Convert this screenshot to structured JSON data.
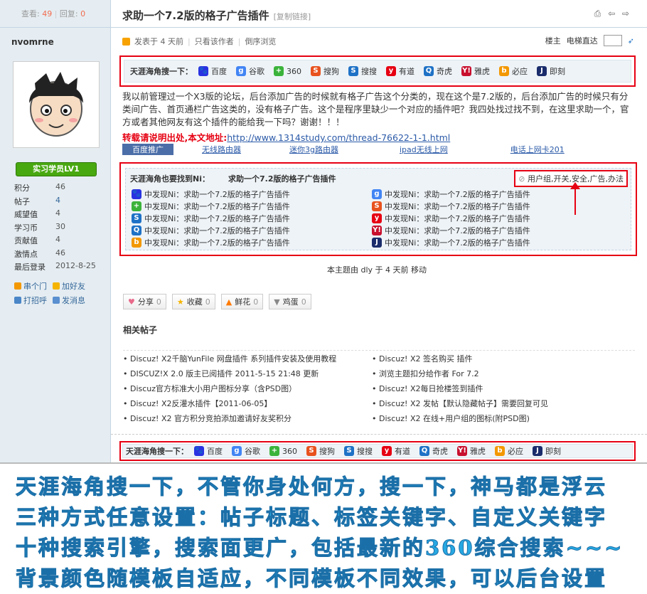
{
  "thread": {
    "views_label": "查看:",
    "views": "49",
    "replies_label": "回复:",
    "replies": "0",
    "title": "求助一个7.2版的格子广告插件",
    "copy_link": "[复制链接]",
    "header_icons": "⎙ ⇦ ⇨"
  },
  "author": {
    "username": "nvomrne",
    "level": "实习学员LV1",
    "stats": [
      {
        "k": "积分",
        "v": "46"
      },
      {
        "k": "帖子",
        "v": "4"
      },
      {
        "k": "威望值",
        "v": "4"
      },
      {
        "k": "学习币",
        "v": "30"
      },
      {
        "k": "贡献值",
        "v": "4"
      },
      {
        "k": "激情点",
        "v": "46"
      },
      {
        "k": "最后登录",
        "v": "2012-8-25"
      }
    ],
    "links": {
      "visit": "串个门",
      "add_friend": "加好友",
      "greet": "打招呼",
      "message": "发消息"
    }
  },
  "meta": {
    "posted": "发表于 4 天前",
    "author_only": "只看该作者",
    "reverse": "倒序浏览",
    "floor": "楼主",
    "elevator": "电梯直达"
  },
  "search_bar": {
    "label": "天涯海角搜一下：",
    "engines": [
      {
        "name": "百度",
        "icon": "baidu-icon",
        "color": "#2932e1",
        "glyph": "🐾"
      },
      {
        "name": "谷歌",
        "icon": "google-icon",
        "color": "#4285f4",
        "glyph": "g"
      },
      {
        "name": "360",
        "icon": "360-icon",
        "color": "#3bb33b",
        "glyph": "+"
      },
      {
        "name": "搜狗",
        "icon": "sogou-icon",
        "color": "#e8521e",
        "glyph": "S"
      },
      {
        "name": "搜搜",
        "icon": "soso-icon",
        "color": "#1e72c6",
        "glyph": "S"
      },
      {
        "name": "有道",
        "icon": "youdao-icon",
        "color": "#e60012",
        "glyph": "y"
      },
      {
        "name": "奇虎",
        "icon": "qihoo-icon",
        "color": "#1e72c6",
        "glyph": "Q"
      },
      {
        "name": "雅虎",
        "icon": "yahoo-icon",
        "color": "#c8102e",
        "glyph": "Y!"
      },
      {
        "name": "必应",
        "icon": "bing-icon",
        "color": "#f39800",
        "glyph": "b"
      },
      {
        "name": "即刻",
        "icon": "jike-icon",
        "color": "#1a2c6b",
        "glyph": "J"
      }
    ]
  },
  "post": {
    "body": "我以前管理过一个X3版的论坛，后台添加广告的时候就有格子广告这个分类的，现在这个是7.2版的，后台添加广告的时候只有分类间广告、首页通栏广告这类的，没有格子广告。这个是程序里缺少一个对应的插件吧？我四处找过找不到，在这里求助一个，官方或者其他网友有这个插件的能给我一下吗？谢谢！！！",
    "repost_label": "转载请说明出处,本文地址:",
    "repost_url": "http://www.1314study.com/thread-76622-1-1.html",
    "ads": [
      "百度推广",
      "无线路由器",
      "迷你3g路由器",
      "ipad无线上网",
      "电话上网卡201"
    ]
  },
  "related_search": {
    "heading": "天涯海角也要找到Ni：",
    "query": "求助一个7.2版的格子广告插件",
    "tags": "用户组,开关,安全,广告,办法",
    "item_prefix": "中发现Ni：",
    "left": [
      {
        "icon": "baidu-icon",
        "color": "#2932e1",
        "glyph": "🐾",
        "text": "中发现Ni：求助一个7.2版的格子广告插件"
      },
      {
        "icon": "360-icon",
        "color": "#3bb33b",
        "glyph": "+",
        "text": "中发现Ni：求助一个7.2版的格子广告插件"
      },
      {
        "icon": "soso-icon",
        "color": "#1e72c6",
        "glyph": "S",
        "text": "中发现Ni：求助一个7.2版的格子广告插件"
      },
      {
        "icon": "qihoo-icon",
        "color": "#1e72c6",
        "glyph": "Q",
        "text": "中发现Ni：求助一个7.2版的格子广告插件"
      },
      {
        "icon": "bing-icon",
        "color": "#f39800",
        "glyph": "b",
        "text": "中发现Ni：求助一个7.2版的格子广告插件"
      }
    ],
    "right": [
      {
        "icon": "google-icon",
        "color": "#4285f4",
        "glyph": "g",
        "text": "中发现Ni：求助一个7.2版的格子广告插件"
      },
      {
        "icon": "sogou-icon",
        "color": "#e8521e",
        "glyph": "S",
        "text": "中发现Ni：求助一个7.2版的格子广告插件"
      },
      {
        "icon": "youdao-icon",
        "color": "#e60012",
        "glyph": "y",
        "text": "中发现Ni：求助一个7.2版的格子广告插件"
      },
      {
        "icon": "yahoo-icon",
        "color": "#c8102e",
        "glyph": "Y!",
        "text": "中发现Ni：求助一个7.2版的格子广告插件"
      },
      {
        "icon": "jike-icon",
        "color": "#1a2c6b",
        "glyph": "J",
        "text": "中发现Ni：求助一个7.2版的格子广告插件"
      }
    ]
  },
  "moved_note": "本主题由 dly 于 4 天前 移动",
  "actions": [
    {
      "label": "分享",
      "count": "0",
      "icon": "heart-icon",
      "color": "#e86a8a"
    },
    {
      "label": "收藏",
      "count": "0",
      "icon": "star-icon",
      "color": "#f5b400"
    },
    {
      "label": "鲜花",
      "count": "0",
      "icon": "thumb-up-icon",
      "color": "#ff7a00"
    },
    {
      "label": "鸡蛋",
      "count": "0",
      "icon": "thumb-down-icon",
      "color": "#888888"
    }
  ],
  "related_posts": {
    "title": "相关帖子",
    "left": [
      "• Discuz! X2千脑YunFile 网盘插件 系列插件安装及使用教程",
      "• DISCUZ!X 2.0 版主已阅插件 2011-5-15 21:48 更新",
      "• Discuz官方标准大小用户图标分享（含PSD图）",
      "• Discuz! X2反灌水插件【2011-06-05】",
      "• Discuz! X2 官方积分竞拍添加邀请好友奖积分"
    ],
    "right": [
      "• Discuz! X2 签名购买 插件",
      "• 浏览主题扣分给作者 For 7.2",
      "• Discuz! X2每日抢楼签到插件",
      "• Discuz! X2 发帖【默认隐藏帖子】需要回复可见",
      "• Discuz! X2 在线+用户组的图标(附PSD图)"
    ]
  },
  "caption": [
    "天涯海角搜一下，不管你身处何方，搜一下，神马都是浮云",
    "三种方式任意设置：帖子标题、标签关键字、自定义关键字",
    "十种搜索引擎，搜索面更广，包括最新的360综合搜索~~~",
    "背景颜色随模板自适应，不同模板不同效果，可以后台设置"
  ]
}
